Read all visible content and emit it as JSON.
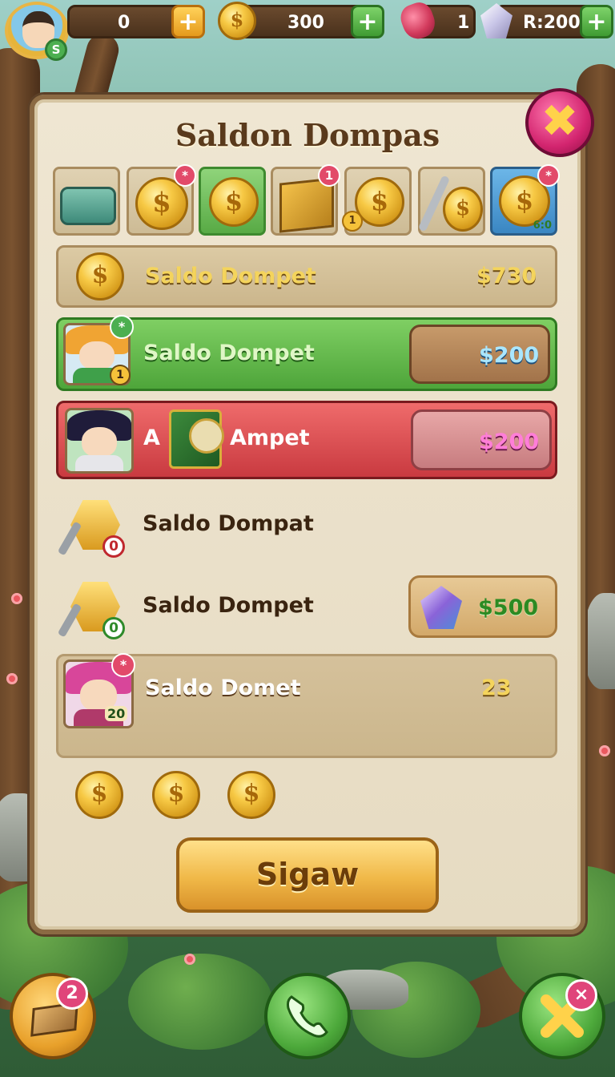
{
  "topbar": {
    "avatar_level": "S",
    "res1_value": "0",
    "coins_value": "300",
    "gems_value": "1",
    "crystal_value": "R:200",
    "plus": "+"
  },
  "panel": {
    "title": "Saldon Dompas",
    "close": "✖"
  },
  "tabs": [
    {
      "badge": "",
      "num": "",
      "small": ""
    },
    {
      "badge": "*",
      "num": "",
      "small": ""
    },
    {
      "badge": "",
      "num": "",
      "small": ""
    },
    {
      "badge": "1",
      "num": "",
      "small": ""
    },
    {
      "badge": "",
      "num": "1",
      "small": ""
    },
    {
      "badge": "",
      "num": "",
      "small": ""
    },
    {
      "badge": "*",
      "num": "",
      "small": "6:0"
    }
  ],
  "rows": {
    "r1": {
      "label": "Saldo Dompet",
      "amount": "$730"
    },
    "r2": {
      "label": "Saldo Dompet",
      "amount": "$200",
      "badge": "*",
      "level": "1"
    },
    "r3": {
      "label_a": "A",
      "label_b": "Ampet",
      "amount": "$200"
    },
    "r4": {
      "label": "Saldo Dompat",
      "count": "0"
    },
    "r5": {
      "label": "Saldo Dompet",
      "count": "0",
      "amount": "$500"
    },
    "r6": {
      "label": "Saldo Domet",
      "amount": "23",
      "badge": "*",
      "level": "20"
    }
  },
  "coin_symbol": "$",
  "action_button": "Sigaw",
  "bottom": {
    "left_badge": "2",
    "right_badge": "×"
  },
  "colors": {
    "panel_bg": "#efe6d2",
    "green_row": "#58aa45",
    "red_row": "#c93a40",
    "gold": "#f0b848"
  }
}
